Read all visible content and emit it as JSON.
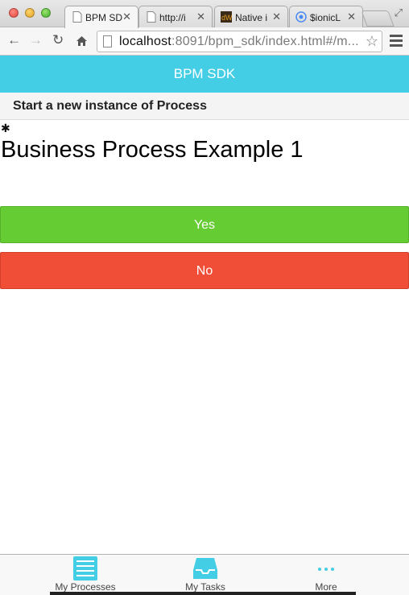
{
  "browser": {
    "tabs": [
      {
        "label": "BPM SD",
        "active": true
      },
      {
        "label": "http://i"
      },
      {
        "label": "Native i"
      },
      {
        "label": "$ionicL"
      }
    ],
    "url_host": "localhost",
    "url_rest": ":8091/bpm_sdk/index.html#/m..."
  },
  "app": {
    "header_title": "BPM SDK",
    "subheader": "Start a new instance of Process",
    "process_title": "Business Process Example 1",
    "buttons": {
      "yes": "Yes",
      "no": "No"
    },
    "tabbar": [
      {
        "label": "My Processes",
        "icon": "list-icon"
      },
      {
        "label": "My Tasks",
        "icon": "inbox-icon"
      },
      {
        "label": "More",
        "icon": "more-icon"
      }
    ]
  },
  "colors": {
    "header": "#43cee6",
    "yes": "#66cc33",
    "no": "#f04e37",
    "tab_icon": "#43cee6"
  }
}
